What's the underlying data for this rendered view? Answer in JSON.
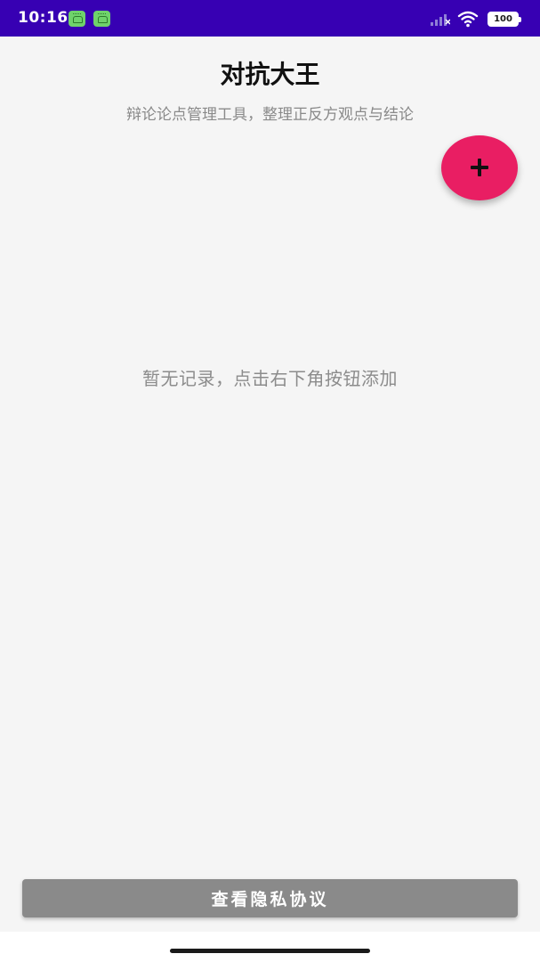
{
  "status_bar": {
    "time": "10:16",
    "battery": "100",
    "background_color": "#3700b3",
    "icons": [
      "android-notification-icon",
      "android-notification-icon",
      "signal-icon",
      "wifi-icon",
      "battery-icon"
    ]
  },
  "header": {
    "title": "对抗大王",
    "subtitle": "辩论论点管理工具，整理正反方观点与结论"
  },
  "fab": {
    "icon": "plus-icon",
    "color": "#e91e63"
  },
  "main": {
    "empty_message": "暂无记录，点击右下角按钮添加"
  },
  "footer": {
    "privacy_button_label": "查看隐私协议",
    "button_color": "#8a8a8a"
  }
}
